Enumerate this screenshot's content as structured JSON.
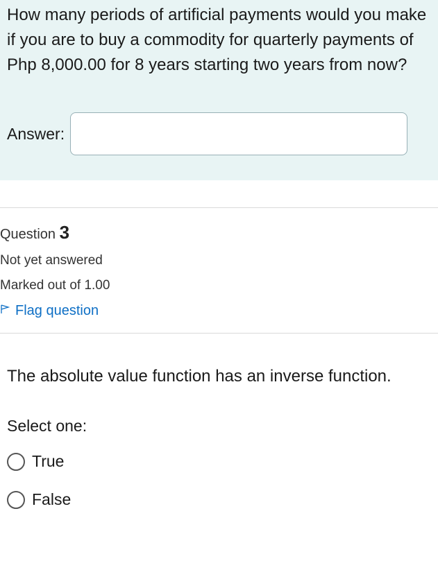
{
  "q1": {
    "text": "How many periods of artificial payments would you make if you are to buy a commodity for quarterly payments of Php 8,000.00 for 8 years starting two years from now?",
    "answer_label": "Answer:",
    "answer_value": ""
  },
  "q3": {
    "header_prefix": "Question ",
    "number": "3",
    "status": "Not yet answered",
    "marks": "Marked out of 1.00",
    "flag_label": "Flag question",
    "question_text": "The absolute value function has an inverse function.",
    "select_label": "Select one:",
    "options": {
      "true": "True",
      "false": "False"
    }
  }
}
